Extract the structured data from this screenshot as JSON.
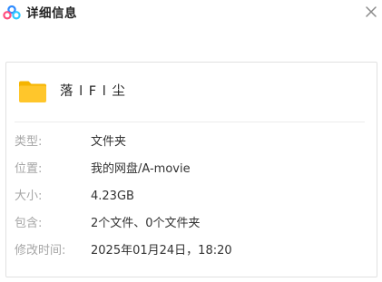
{
  "header": {
    "title": "详细信息",
    "logo_icon": "baidu-netdisk-cloud-logo",
    "close_icon": "close-x"
  },
  "file": {
    "icon": "folder-icon",
    "name": "落 l F l 尘"
  },
  "details": [
    {
      "label": "类型:",
      "value": "文件夹"
    },
    {
      "label": "位置:",
      "value": "我的网盘/A-movie"
    },
    {
      "label": "大小:",
      "value": "4.23GB"
    },
    {
      "label": "包含:",
      "value": "2个文件、0个文件夹"
    },
    {
      "label": "修改时间:",
      "value": "2025年01月24日，18:20"
    }
  ],
  "colors": {
    "folder": "#ffc62b",
    "logo_blue": "#2e8bff",
    "logo_cyan": "#30c9ff",
    "logo_pink": "#ff4d7e"
  }
}
